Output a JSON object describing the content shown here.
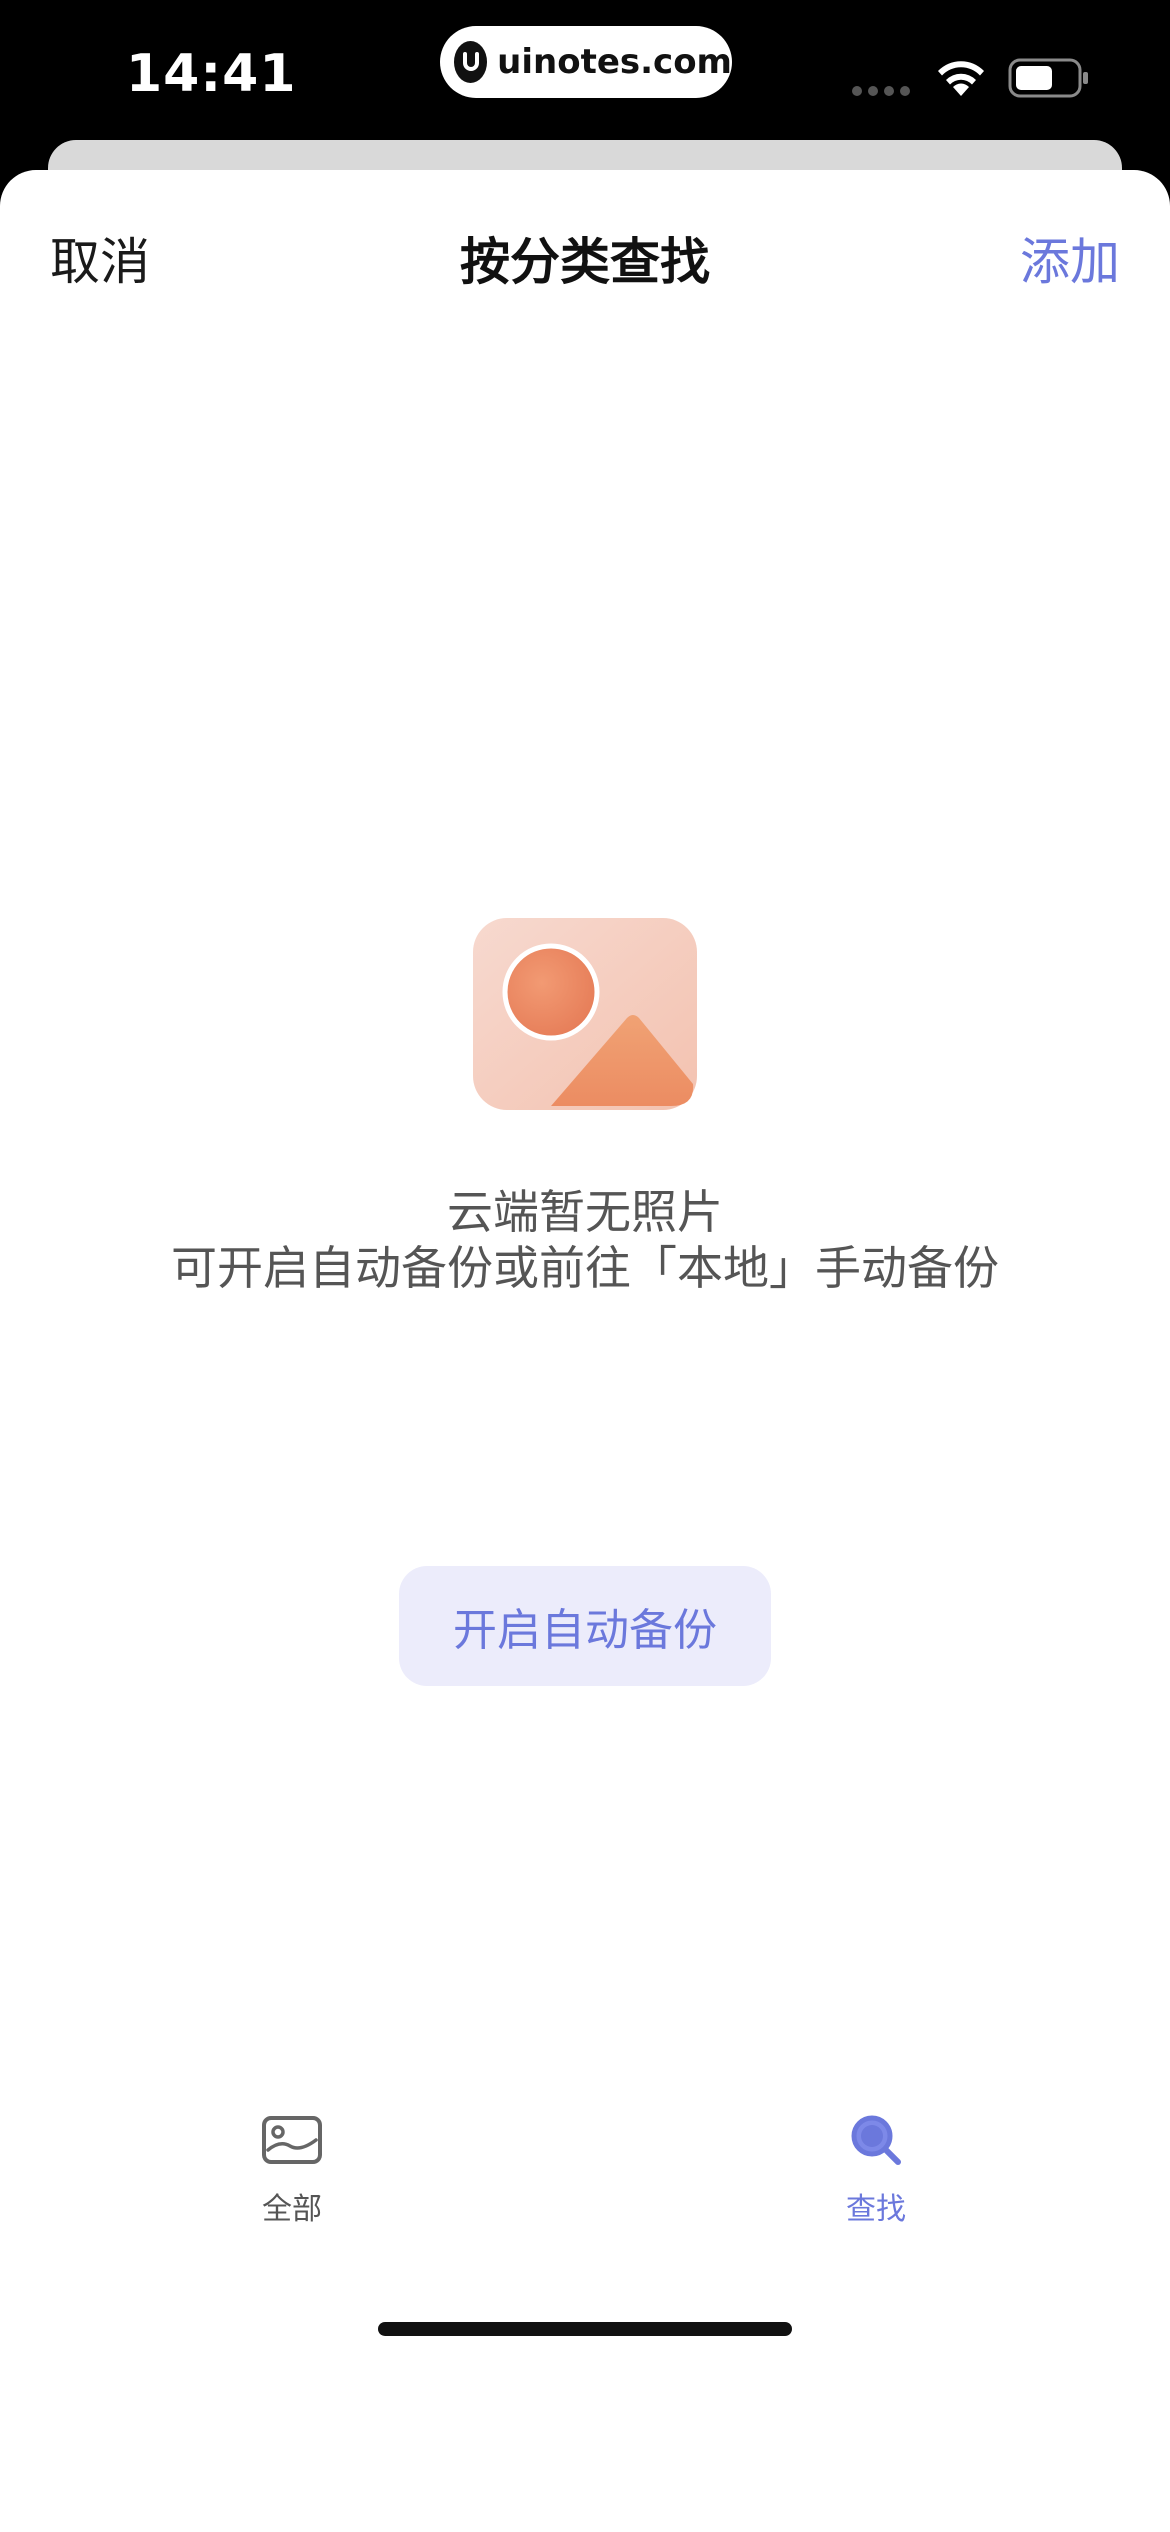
{
  "status_bar": {
    "time": "14:41",
    "url": "uinotes.com"
  },
  "nav": {
    "cancel_label": "取消",
    "title": "按分类查找",
    "add_label": "添加"
  },
  "empty_state": {
    "title": "云端暂无照片",
    "subtitle": "可开启自动备份或前往「本地」手动备份",
    "button_label": "开启自动备份"
  },
  "tabs": [
    {
      "label": "全部",
      "icon": "photo-card-icon",
      "active": false
    },
    {
      "label": "查找",
      "icon": "search-icon",
      "active": true
    }
  ],
  "colors": {
    "accent": "#6b78dc",
    "button_bg": "#ececfb",
    "text_secondary": "#555555"
  }
}
